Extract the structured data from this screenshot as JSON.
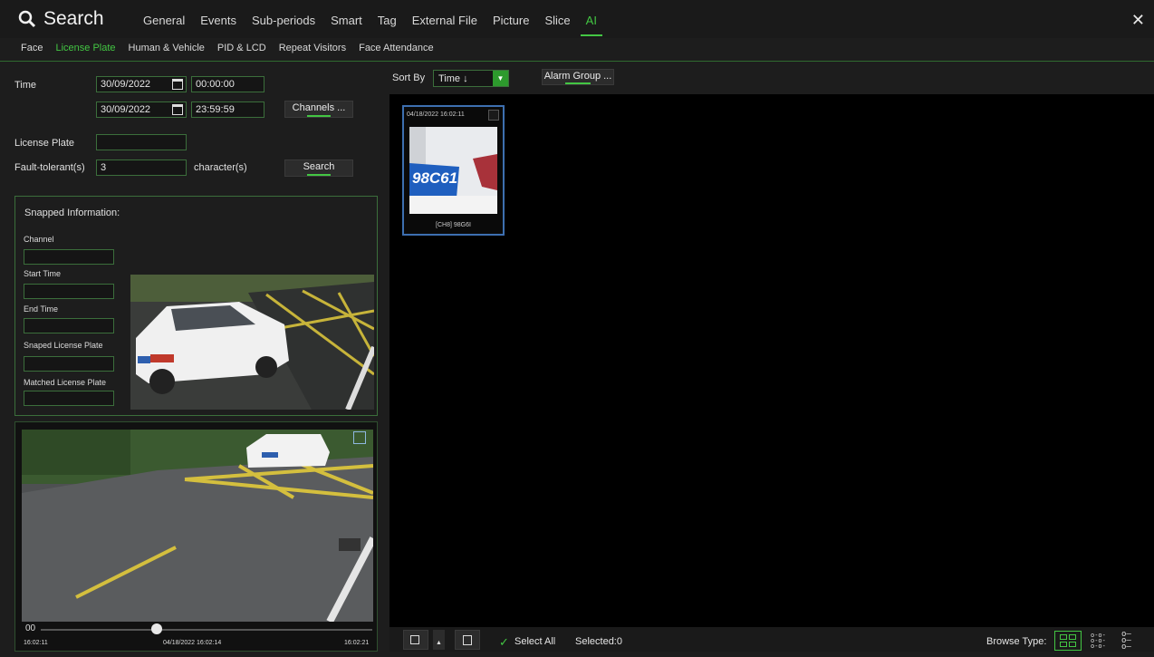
{
  "header": {
    "title": "Search",
    "tabs": [
      "General",
      "Events",
      "Sub-periods",
      "Smart",
      "Tag",
      "External File",
      "Picture",
      "Slice",
      "AI"
    ],
    "active_tab": "AI",
    "close_icon": "close-icon"
  },
  "subtabs": {
    "items": [
      "Face",
      "License Plate",
      "Human & Vehicle",
      "PID & LCD",
      "Repeat Visitors",
      "Face Attendance"
    ],
    "active": "License Plate"
  },
  "form": {
    "time_label": "Time",
    "start_date": "30/09/2022",
    "start_time": "00:00:00",
    "end_date": "30/09/2022",
    "end_time": "23:59:59",
    "channels_button": "Channels ...",
    "license_plate_label": "License Plate",
    "license_plate_value": "",
    "fault_tolerant_label": "Fault-tolerant(s)",
    "fault_tolerant_value": "3",
    "character_label": "character(s)",
    "search_button": "Search"
  },
  "snapped": {
    "title": "Snapped Information:",
    "channel_label": "Channel",
    "start_time_label": "Start Time",
    "end_time_label": "End Time",
    "snaped_plate_label": "Snaped License Plate",
    "matched_plate_label": "Matched License Plate"
  },
  "playback": {
    "counter": "00",
    "start": "16:02:11",
    "current": "04/18/2022 16:02:14",
    "end": "16:02:21",
    "progress": 0.35
  },
  "sort": {
    "label": "Sort By",
    "value": "Time ↓",
    "alarm_group_button": "Alarm Group ..."
  },
  "results": [
    {
      "timestamp": "04/18/2022 16:02:11",
      "caption": "[CH8] 98G6I",
      "plate_text": "98C61"
    }
  ],
  "footer": {
    "select_all": "Select All",
    "selected": "Selected:0",
    "browse_type": "Browse Type:"
  },
  "colors": {
    "accent": "#43c643",
    "card_border": "#3d6fb0"
  }
}
